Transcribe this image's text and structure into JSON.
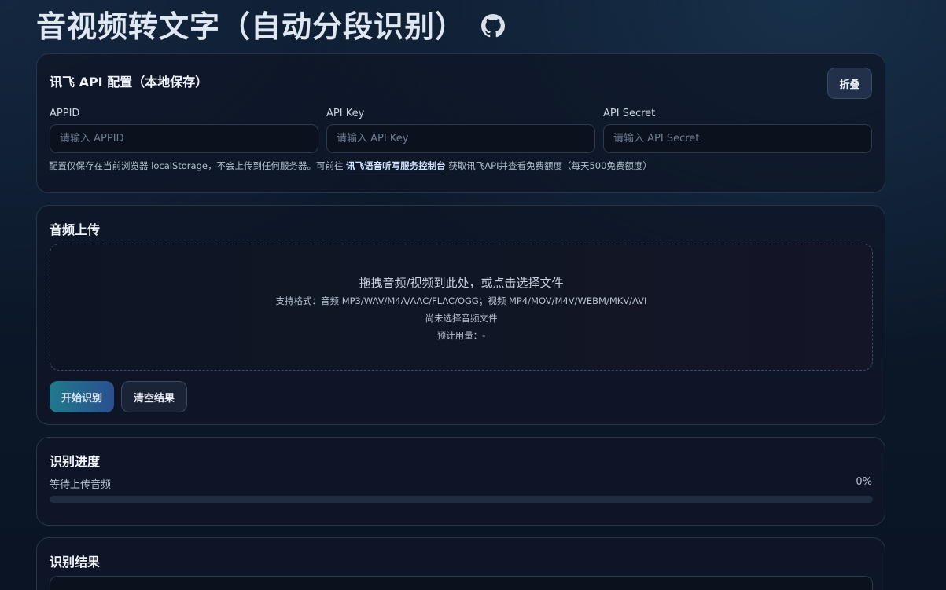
{
  "header": {
    "title": "音视频转文字（自动分段识别）",
    "github_icon": "github-icon"
  },
  "config": {
    "title": "讯飞 API 配置（本地保存）",
    "collapse_label": "折叠",
    "appid_label": "APPID",
    "appid_placeholder": "请输入 APPID",
    "appid_value": "",
    "apikey_label": "API Key",
    "apikey_placeholder": "请输入 API Key",
    "apikey_value": "",
    "apisecret_label": "API Secret",
    "apisecret_placeholder": "请输入 API Secret",
    "apisecret_value": "",
    "hint_prefix": "配置仅保存在当前浏览器 localStorage，不会上传到任何服务器。可前往 ",
    "hint_link": "讯飞语音听写服务控制台",
    "hint_suffix": " 获取讯飞API并查看免费额度（每天500免费额度）"
  },
  "upload": {
    "title": "音频上传",
    "drop_main": "拖拽音频/视频到此处，或点击选择文件",
    "formats": "支持格式：音频 MP3/WAV/M4A/AAC/FLAC/OGG；视频 MP4/MOV/M4V/WEBM/MKV/AVI",
    "file_status": "尚未选择音频文件",
    "usage_estimate": "预计用量：-",
    "start_label": "开始识别",
    "clear_label": "清空结果"
  },
  "progress": {
    "title": "识别进度",
    "status": "等待上传音频",
    "percent_text": "0%",
    "percent_value": 0
  },
  "result": {
    "title": "识别结果"
  },
  "colors": {
    "accent_start": "#1f7a8c",
    "accent_end": "#2a4f8f",
    "link": "#cfe1ff"
  }
}
